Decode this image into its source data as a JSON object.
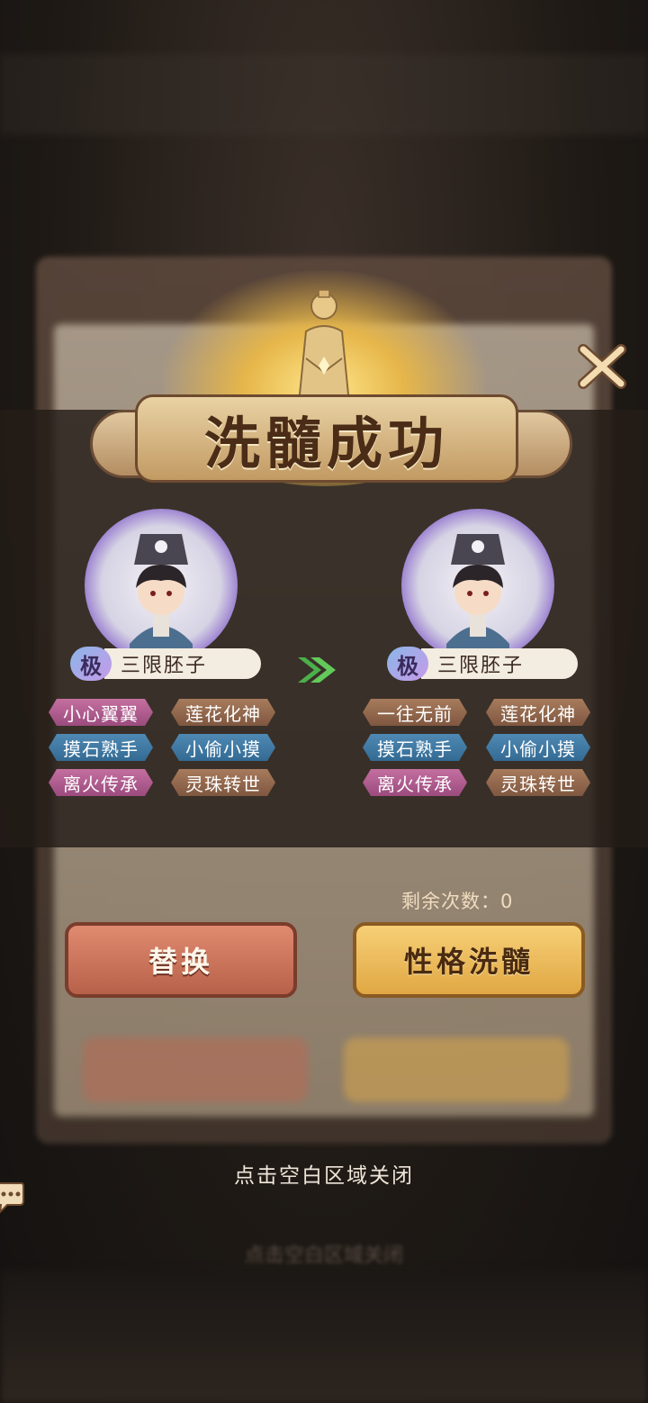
{
  "banner": {
    "title": "洗髓成功"
  },
  "left_character": {
    "grade": "极",
    "name": "三限胚子",
    "traits": [
      {
        "label": "小心翼翼",
        "color": "pink"
      },
      {
        "label": "莲花化神",
        "color": "brown"
      },
      {
        "label": "摸石熟手",
        "color": "blue"
      },
      {
        "label": "小偷小摸",
        "color": "blue"
      },
      {
        "label": "离火传承",
        "color": "pink"
      },
      {
        "label": "灵珠转世",
        "color": "brown"
      }
    ]
  },
  "right_character": {
    "grade": "极",
    "name": "三限胚子",
    "traits": [
      {
        "label": "一往无前",
        "color": "brown"
      },
      {
        "label": "莲花化神",
        "color": "brown"
      },
      {
        "label": "摸石熟手",
        "color": "blue"
      },
      {
        "label": "小偷小摸",
        "color": "blue"
      },
      {
        "label": "离火传承",
        "color": "pink"
      },
      {
        "label": "灵珠转世",
        "color": "brown"
      }
    ]
  },
  "remaining": {
    "label": "剩余次数：0"
  },
  "buttons": {
    "replace": "替换",
    "wash": "性格洗髓"
  },
  "hint": "点击空白区域关闭",
  "background_hint": "点击空白区域关闭",
  "colors": {
    "pink": "#b45a8e",
    "blue": "#3f78a3",
    "brown": "#94694d",
    "accent": "#e7b34e"
  }
}
